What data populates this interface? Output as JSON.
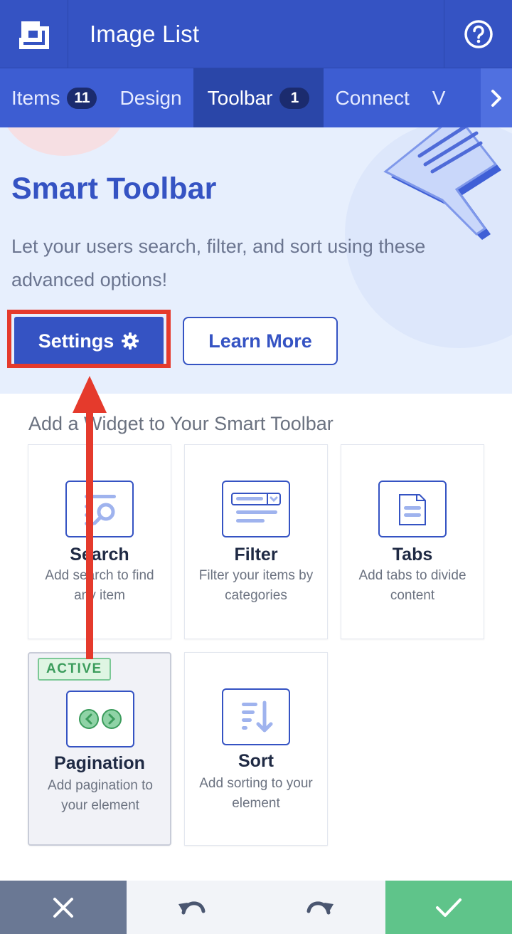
{
  "header": {
    "title": "Image List",
    "logo_icon": "brand-logo-icon",
    "help_icon": "help-circle-icon"
  },
  "tabs": [
    {
      "label": "Items",
      "count": "11"
    },
    {
      "label": "Design"
    },
    {
      "label": "Toolbar",
      "count": "1",
      "active": true
    },
    {
      "label": "Connect"
    },
    {
      "label": "V"
    }
  ],
  "hero": {
    "title": "Smart Toolbar",
    "description": "Let your users search, filter, and sort using these advanced options!",
    "settings_label": "Settings",
    "learn_more_label": "Learn More"
  },
  "widgets": {
    "section_title": "Add a Widget to Your Smart Toolbar",
    "items": [
      {
        "name": "Search",
        "description": "Add search to find any item",
        "icon": "search-widget-icon"
      },
      {
        "name": "Filter",
        "description": "Filter your items by categories",
        "icon": "filter-widget-icon"
      },
      {
        "name": "Tabs",
        "description": "Add tabs to divide content",
        "icon": "tabs-widget-icon"
      },
      {
        "name": "Pagination",
        "description": "Add pagination to your element",
        "icon": "pagination-widget-icon",
        "badge": "ACTIVE"
      },
      {
        "name": "Sort",
        "description": "Add sorting to your element",
        "icon": "sort-widget-icon"
      }
    ]
  },
  "footer": {
    "close_icon": "close-icon",
    "undo_icon": "undo-icon",
    "redo_icon": "redo-icon",
    "confirm_icon": "check-icon"
  },
  "colors": {
    "primary": "#3553c3",
    "annotation": "#e53a2c",
    "active_badge": "#3b9c5c",
    "confirm": "#5fc48a"
  }
}
